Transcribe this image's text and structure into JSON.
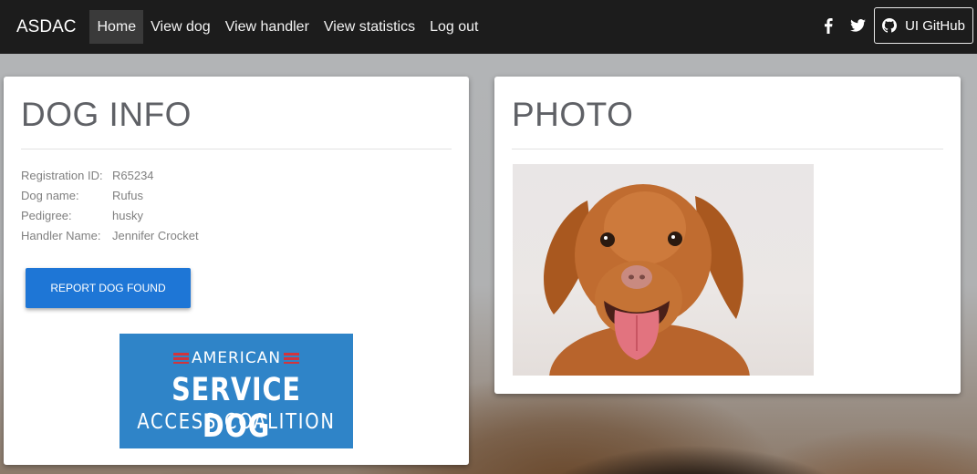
{
  "navbar": {
    "brand": "ASDAC",
    "items": [
      "Home",
      "View dog",
      "View handler",
      "View statistics",
      "Log out"
    ],
    "github_label": "UI GitHub"
  },
  "dog_info": {
    "title": "DOG INFO",
    "fields": [
      {
        "label": "Registration ID:",
        "value": "R65234"
      },
      {
        "label": "Dog name:",
        "value": "Rufus"
      },
      {
        "label": "Pedigree:",
        "value": "husky"
      },
      {
        "label": "Handler Name:",
        "value": "Jennifer Crocket"
      }
    ],
    "report_button": "REPORT DOG FOUND",
    "logo": {
      "line1": "AMERICAN",
      "line2": "SERVICE DOG",
      "line3": "ACCESS COALITION"
    }
  },
  "photo": {
    "title": "PHOTO"
  },
  "colors": {
    "navbar": "#1c1c1c",
    "button": "#1e76d6",
    "logo_blue": "#2f84c8"
  }
}
